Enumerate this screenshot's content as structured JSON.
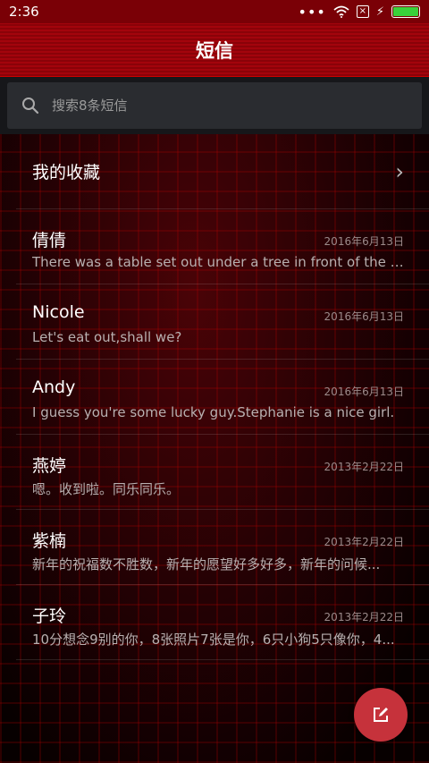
{
  "statusbar": {
    "time": "2:36",
    "icons": [
      "signal-dots-icon",
      "wifi-icon",
      "no-sim-icon",
      "charging-icon",
      "battery-icon"
    ],
    "battery_color": "#3ad23a"
  },
  "header": {
    "title": "短信",
    "accent": "#a3040c"
  },
  "search": {
    "placeholder": "搜索8条短信",
    "icon": "search-icon"
  },
  "favorites": {
    "label": "我的收藏",
    "icon": "chevron-right-icon"
  },
  "conversations": [
    {
      "name": "倩倩",
      "date": "2016年6月13日",
      "preview": "There was a table set out under a tree in front of the ho..."
    },
    {
      "name": "Nicole",
      "date": "2016年6月13日",
      "preview": "Let's eat out,shall we?"
    },
    {
      "name": "Andy",
      "date": "2016年6月13日",
      "preview": "I guess you're some lucky guy.Stephanie is a nice girl."
    },
    {
      "name": "燕婷",
      "date": "2013年2月22日",
      "preview": "嗯。收到啦。同乐同乐。"
    },
    {
      "name": "紫楠",
      "date": "2013年2月22日",
      "preview": "新年的祝福数不胜数，新年的愿望好多好多，新年的问候..."
    },
    {
      "name": "子玲",
      "date": "2013年2月22日",
      "preview": "10分想念9别的你，8张照片7张是你，6只小狗5只像你，4..."
    }
  ],
  "fab": {
    "icon": "compose-icon",
    "color": "#c6323b"
  }
}
